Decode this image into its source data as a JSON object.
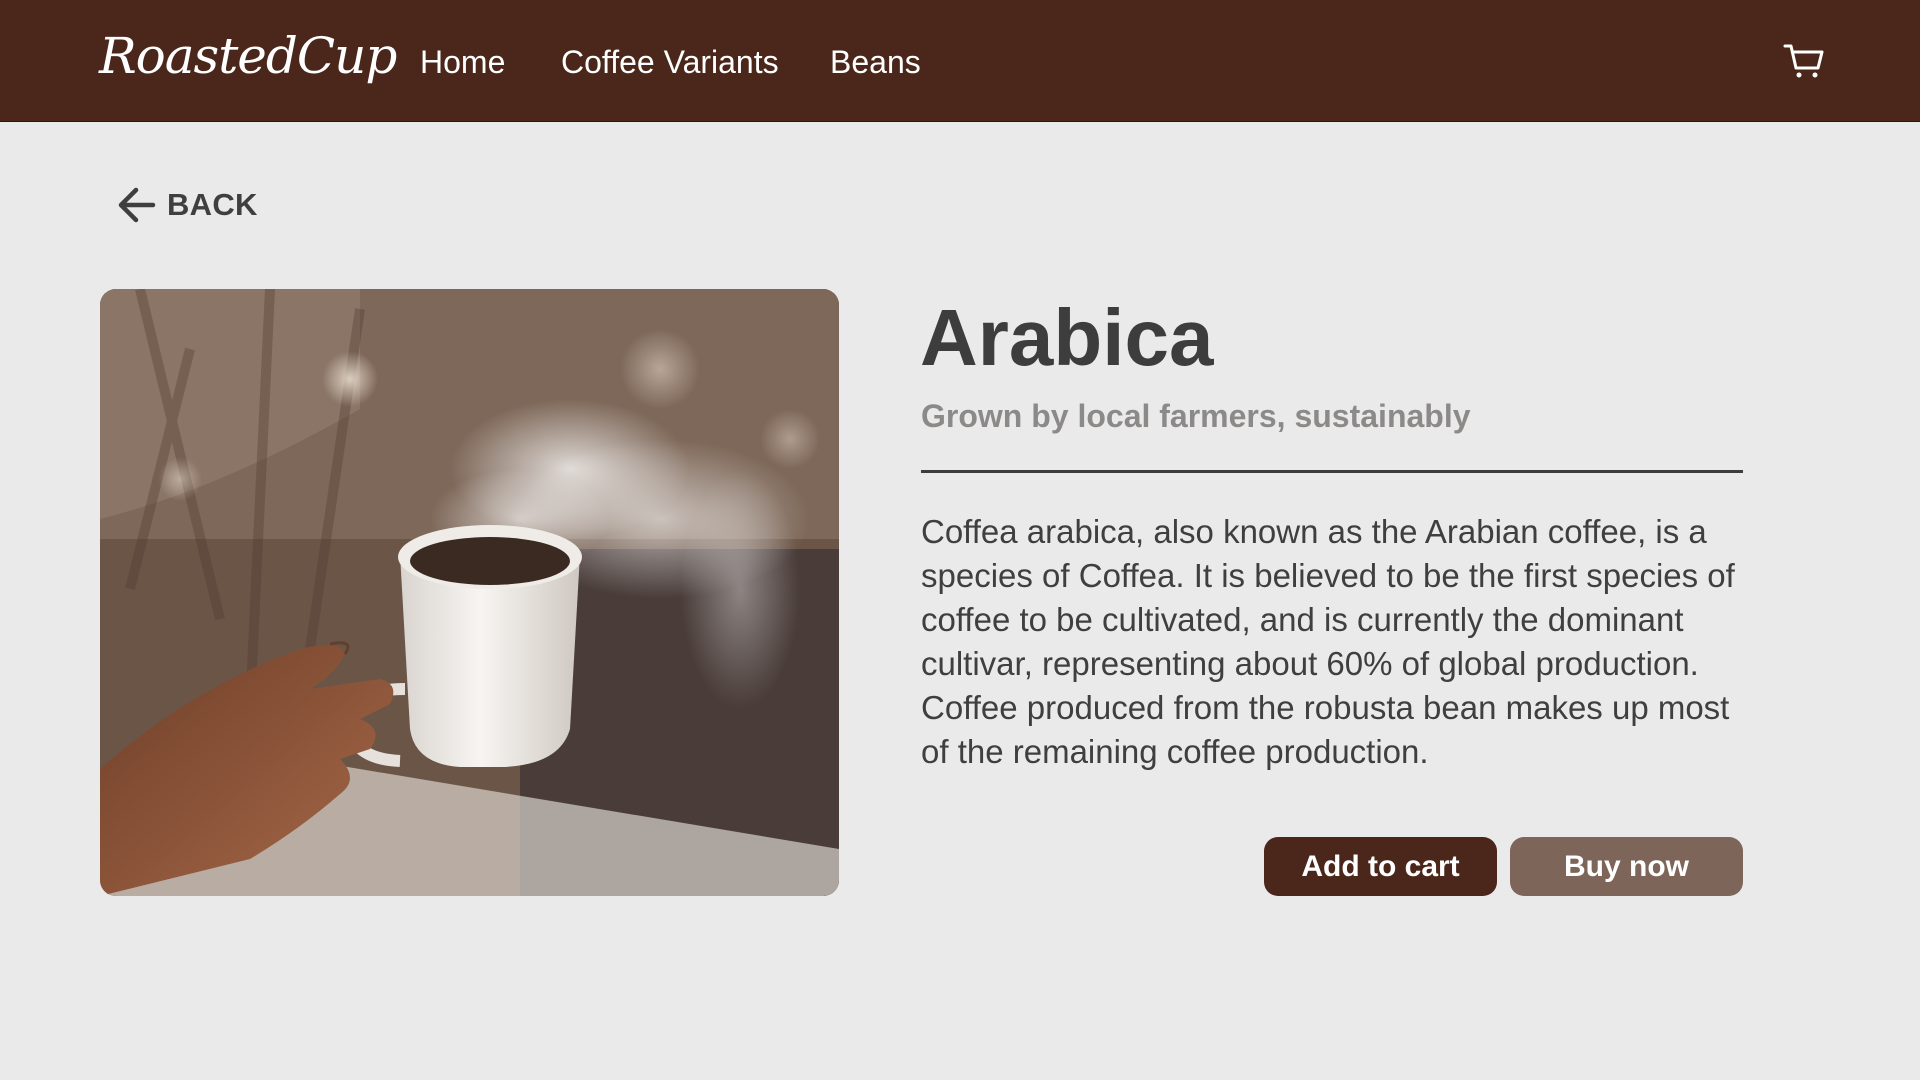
{
  "brand": {
    "logo_text": "RoastedCup",
    "primary_color": "#4a271a",
    "secondary_color": "#7e6559"
  },
  "nav": {
    "links": [
      {
        "label": "Home"
      },
      {
        "label": "Coffee Variants"
      },
      {
        "label": "Beans"
      }
    ],
    "cart_icon": "shopping-cart-icon"
  },
  "back": {
    "icon": "arrow-left-icon",
    "label": "BACK"
  },
  "product": {
    "image_icon": "coffee-cup-photo",
    "name": "Arabica",
    "tagline": "Grown by local farmers, sustainably",
    "description": "Coffea arabica, also known as the Arabian coffee, is a species of Coffea. It is believed to be the first species of coffee to be cultivated, and is currently the dominant cultivar, representing about 60% of global production. Coffee produced from the robusta bean makes up most of the remaining coffee production."
  },
  "actions": {
    "add_to_cart_label": "Add to cart",
    "buy_now_label": "Buy now"
  }
}
